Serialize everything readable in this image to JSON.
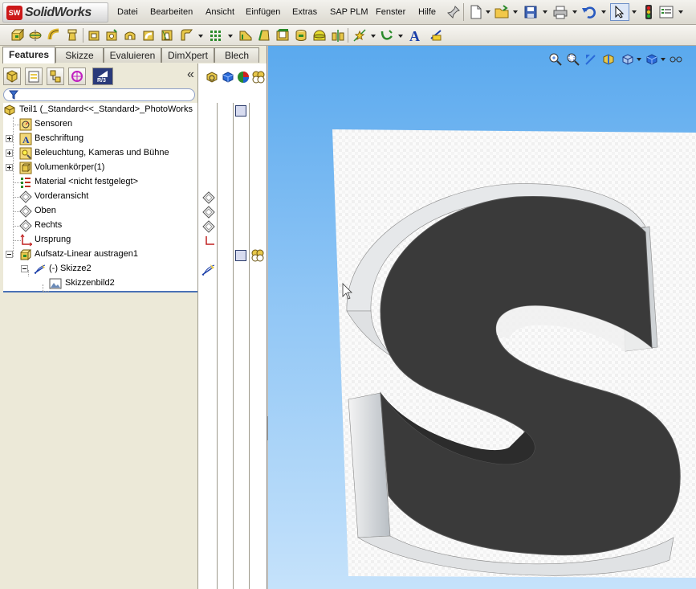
{
  "app": {
    "brand": "SolidWorks",
    "brand_prefix": "Solid",
    "brand_suffix": "Works",
    "logo_mark": "SW"
  },
  "menu": {
    "items": [
      "Datei",
      "Bearbeiten",
      "Ansicht",
      "Einfügen",
      "Extras",
      "SAP PLM",
      "Fenster",
      "Hilfe"
    ]
  },
  "tabs": [
    {
      "label": "Features",
      "active": true
    },
    {
      "label": "Skizze",
      "active": false
    },
    {
      "label": "Evaluieren",
      "active": false
    },
    {
      "label": "DimXpert",
      "active": false
    },
    {
      "label": "Blech",
      "active": false
    }
  ],
  "fm_toolbar": {
    "collapse_label": "«",
    "icons": [
      "feature-manager-icon",
      "property-manager-icon",
      "configuration-manager-icon",
      "dimxpert-manager-icon",
      "display-manager-icon"
    ],
    "dimxpert_text": "R/3"
  },
  "tree": {
    "items": [
      {
        "label": "Teil1  (_Standard<<_Standard>_PhotoWorks",
        "icon": "part-icon"
      },
      {
        "label": "Sensoren",
        "icon": "sensors-icon"
      },
      {
        "label": "Beschriftung",
        "icon": "annotations-icon"
      },
      {
        "label": "Beleuchtung, Kameras und Bühne",
        "icon": "lights-icon"
      },
      {
        "label": "Volumenkörper(1)",
        "icon": "solid-bodies-icon"
      },
      {
        "label": "Material <nicht festgelegt>",
        "icon": "material-icon"
      },
      {
        "label": "Vorderansicht",
        "icon": "plane-icon"
      },
      {
        "label": "Oben",
        "icon": "plane-icon"
      },
      {
        "label": "Rechts",
        "icon": "plane-icon"
      },
      {
        "label": "Ursprung",
        "icon": "origin-icon"
      },
      {
        "label": "Aufsatz-Linear austragen1",
        "icon": "extrude-icon"
      },
      {
        "label": "(-) Skizze2",
        "icon": "sketch-icon"
      },
      {
        "label": "Skizzenbild2",
        "icon": "sketch-picture-icon"
      }
    ]
  },
  "colors": {
    "viewport_top": "#5aa9ee",
    "viewport_bottom": "#c5e2fb",
    "letter_dark": "#3a3a3a",
    "letter_light": "#d8dadc",
    "selection_line": "#4a71b6",
    "brand_red": "#cc1818"
  },
  "viewport": {
    "model_letter": "S"
  }
}
